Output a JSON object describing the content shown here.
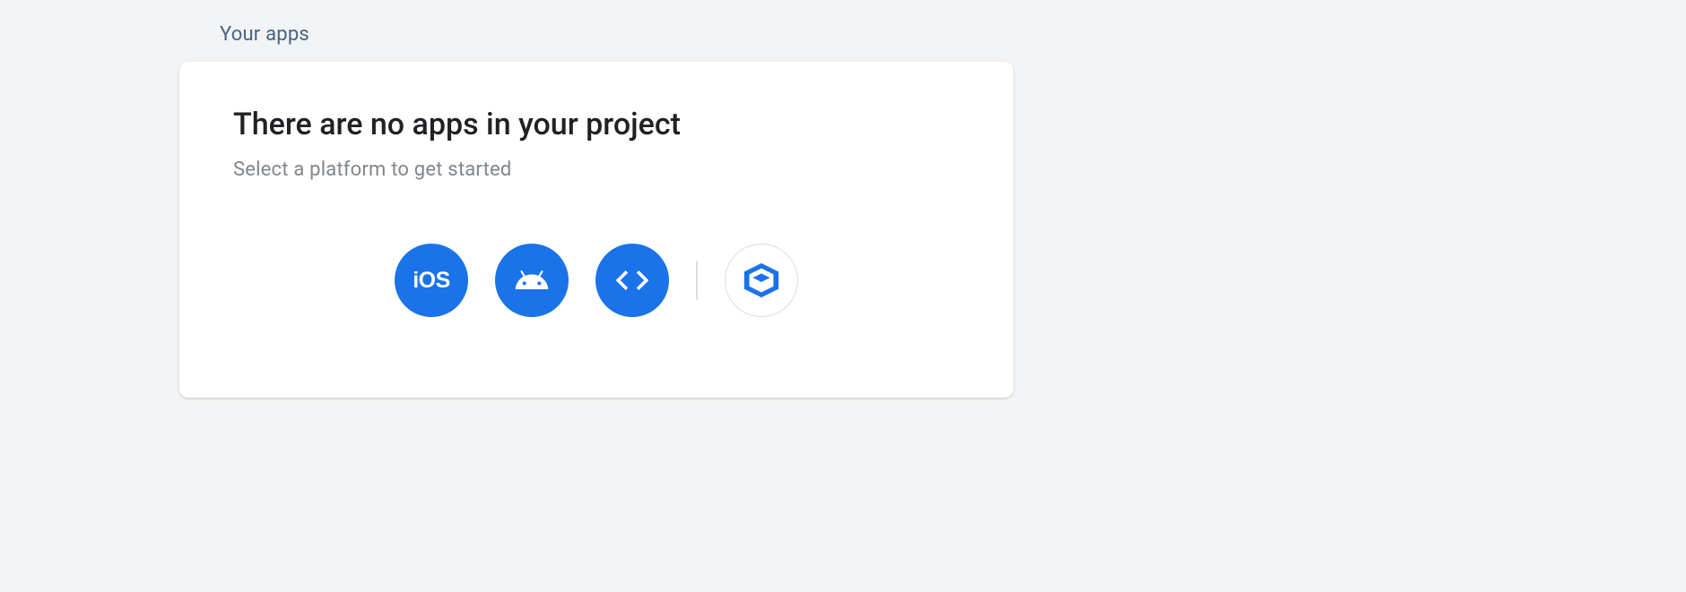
{
  "section": {
    "title": "Your apps"
  },
  "empty": {
    "heading": "There are no apps in your project",
    "sub": "Select a platform to get started"
  },
  "platforms": {
    "ios_label": "iOS",
    "android_label": "Android",
    "web_label": "Web",
    "unity_label": "Unity"
  },
  "colors": {
    "accent": "#1a73e8"
  }
}
